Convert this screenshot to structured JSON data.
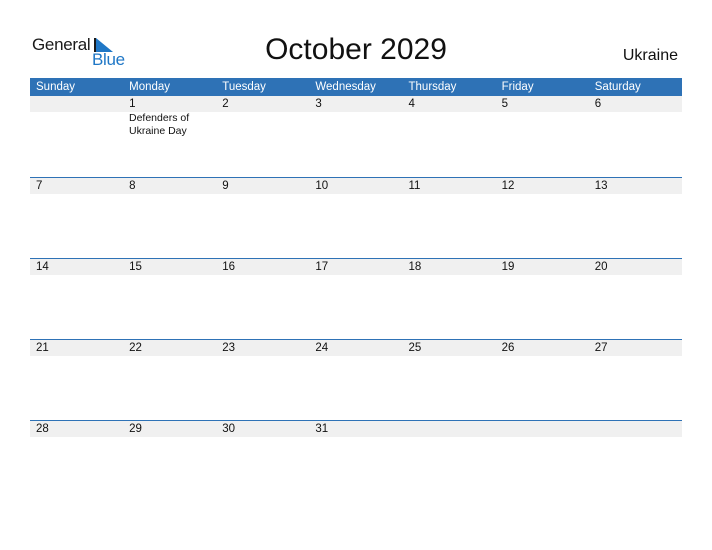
{
  "logo": {
    "general": "General",
    "blue": "Blue",
    "icon": "triangle-flag-icon"
  },
  "header": {
    "title": "October 2029",
    "country": "Ukraine"
  },
  "calendar": {
    "weekdays": [
      "Sunday",
      "Monday",
      "Tuesday",
      "Wednesday",
      "Thursday",
      "Friday",
      "Saturday"
    ],
    "weeks": [
      [
        "",
        "1",
        "2",
        "3",
        "4",
        "5",
        "6"
      ],
      [
        "7",
        "8",
        "9",
        "10",
        "11",
        "12",
        "13"
      ],
      [
        "14",
        "15",
        "16",
        "17",
        "18",
        "19",
        "20"
      ],
      [
        "21",
        "22",
        "23",
        "24",
        "25",
        "26",
        "27"
      ],
      [
        "28",
        "29",
        "30",
        "31",
        "",
        "",
        ""
      ]
    ],
    "holidays": [
      {
        "date": "1",
        "weekday": "Monday",
        "name_line1": "Defenders of",
        "name_line2": "Ukraine Day"
      }
    ]
  },
  "colors": {
    "accent": "#2e72b6",
    "logo_blue": "#1f77c6",
    "date_strip": "#f0f0f0"
  }
}
